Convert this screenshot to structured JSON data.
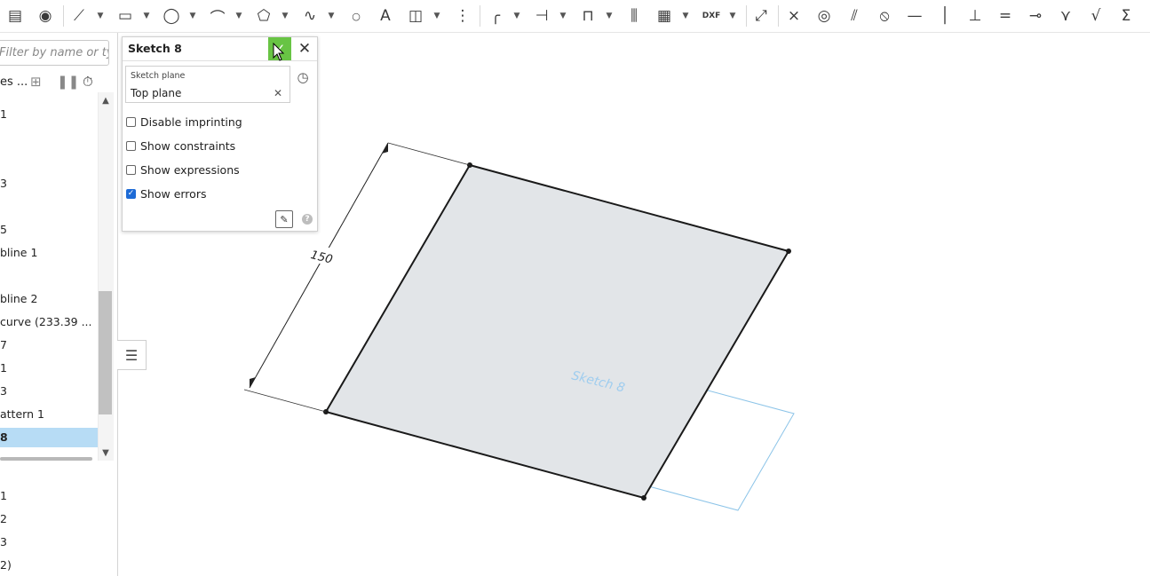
{
  "toolbar": {
    "icons": [
      "part-studio-icon",
      "sketch-feature-icon",
      "line-icon",
      "rectangle-icon",
      "circle-icon",
      "arc-icon",
      "polygon-icon",
      "spline-icon",
      "point-icon",
      "text-icon",
      "construction-icon",
      "mirror-icon",
      "fillet-icon",
      "trim-icon",
      "offset-icon",
      "pattern-icon",
      "dxf-import-icon",
      "project-icon",
      "coincident-icon",
      "concentric-icon",
      "parallel-icon",
      "tangent-icon",
      "horizontal-icon",
      "vertical-icon",
      "perpendicular-icon",
      "equal-icon",
      "midpoint-icon",
      "normal-icon",
      "dimension-icon",
      "variable-icon"
    ],
    "dxf_label": "DXF"
  },
  "feature_list": {
    "filter_placeholder": "Filter by name or type",
    "header_label": "es ...",
    "items": [
      {
        "label": "1"
      },
      {
        "label": "3"
      },
      {
        "label": "5"
      },
      {
        "label": "bline 1"
      },
      {
        "label": "bline 2"
      },
      {
        "label": "curve (233.39 ..."
      },
      {
        "label": "7"
      },
      {
        "label": "1"
      },
      {
        "label": "3"
      },
      {
        "label": "attern 1"
      },
      {
        "label": "8"
      }
    ],
    "lower_items": [
      {
        "label": "1"
      },
      {
        "label": "2"
      },
      {
        "label": "3"
      },
      {
        "label": "2)"
      }
    ]
  },
  "dialog": {
    "title": "Sketch 8",
    "sketch_plane_label": "Sketch plane",
    "sketch_plane_value": "Top plane",
    "clear_glyph": "✕",
    "options": [
      {
        "label": "Disable imprinting",
        "checked": false
      },
      {
        "label": "Show constraints",
        "checked": false
      },
      {
        "label": "Show expressions",
        "checked": false
      },
      {
        "label": "Show errors",
        "checked": true
      }
    ],
    "help_glyph": "?"
  },
  "viewport": {
    "dimension_value": "150",
    "plane_label": "Sketch 8"
  },
  "colors": {
    "accent_green": "#68c444",
    "selection_blue": "#b7dcf5",
    "plane_outline": "#8cc4e8",
    "sketch_fill": "#e2e5e8"
  }
}
